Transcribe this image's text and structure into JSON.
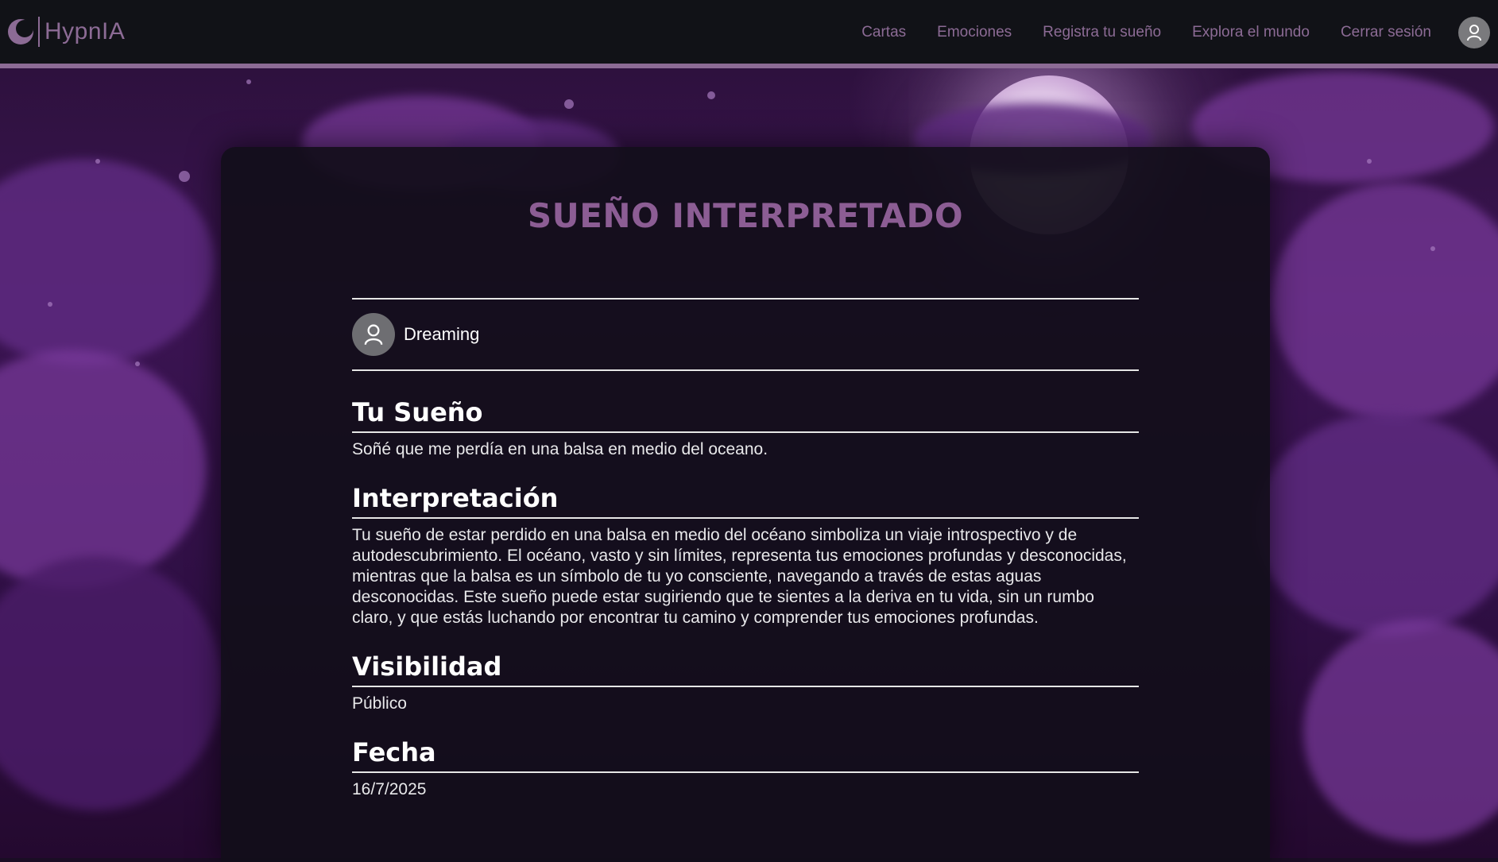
{
  "nav": {
    "brand": "HypnIA",
    "links": [
      "Cartas",
      "Emociones",
      "Registra tu sueño",
      "Explora el mundo",
      "Cerrar sesión"
    ]
  },
  "card": {
    "title": "SUEÑO INTERPRETADO",
    "user": "Dreaming",
    "sections": [
      {
        "title": "Tu Sueño",
        "text": "Soñé que me perdía en una balsa en medio del oceano."
      },
      {
        "title": "Interpretación",
        "text": "Tu sueño de estar perdido en una balsa en medio del océano simboliza un viaje introspectivo y de autodescubrimiento. El océano, vasto y sin límites, representa tus emociones profundas y desconocidas, mientras que la balsa es un símbolo de tu yo consciente, navegando a través de estas aguas desconocidas. Este sueño puede estar sugiriendo que te sientes a la deriva en tu vida, sin un rumbo claro, y que estás luchando por encontrar tu camino y comprender tus emociones profundas."
      },
      {
        "title": "Visibilidad",
        "text": "Público"
      },
      {
        "title": "Fecha",
        "text": "16/7/2025"
      }
    ]
  },
  "colors": {
    "accent": "#8c6b95",
    "title": "#8c5d94",
    "navBg": "#111217",
    "cardBg": "#120e1a"
  },
  "icons": {
    "logo": "crescent-moon-icon",
    "avatar": "user-icon"
  }
}
